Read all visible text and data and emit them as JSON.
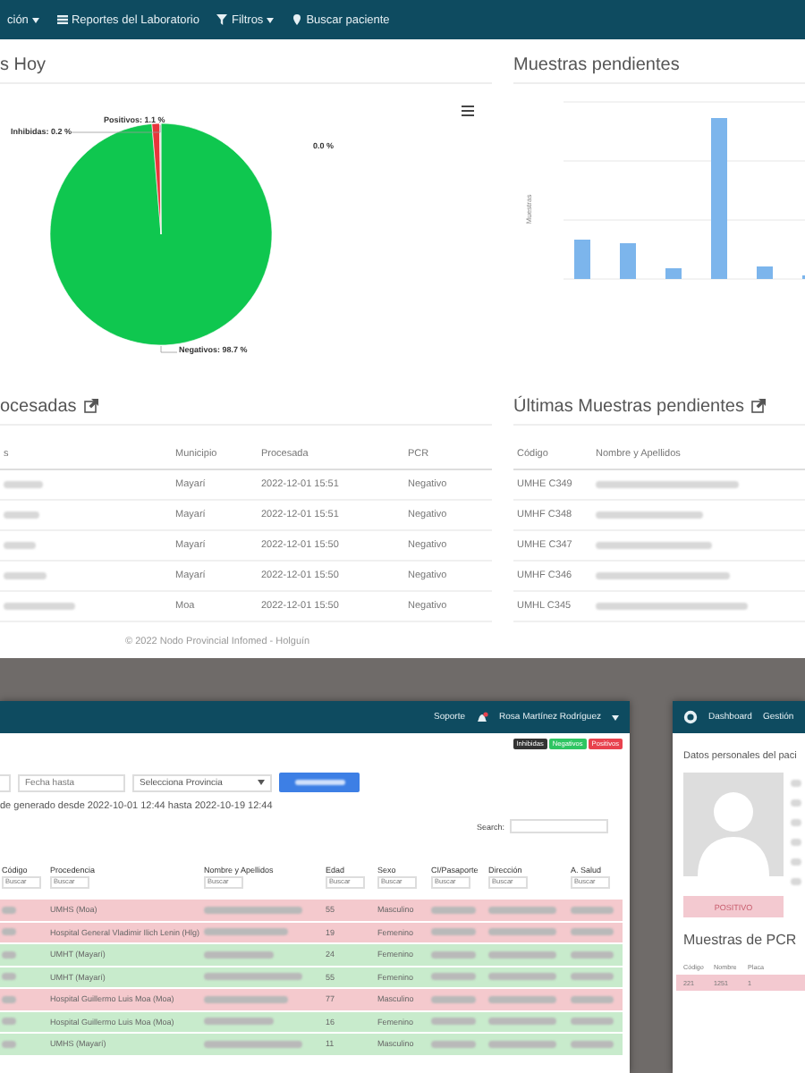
{
  "navbar": {
    "items": [
      {
        "label": "ción",
        "kind": "menu"
      },
      {
        "label": "Reportes del Laboratorio",
        "kind": "link"
      },
      {
        "label": "Filtros",
        "kind": "menu"
      },
      {
        "label": "Buscar paciente",
        "kind": "link"
      }
    ]
  },
  "results_panel": {
    "title": "s Hoy",
    "chart_data": {
      "type": "pie",
      "values": [
        98.7,
        1.1,
        0.2,
        0.0
      ],
      "value_labels": [
        "Negativos: 98.7 %",
        "Positivos: 1.1 %",
        "Inhibidas: 0.2 %",
        "0.0 %"
      ]
    }
  },
  "pending_panel": {
    "title": "Muestras pendientes",
    "ylabel": "Muestras"
  },
  "processed_table": {
    "title": "ocesadas",
    "columns": [
      "s",
      "Municipio",
      "Procesada",
      "PCR"
    ],
    "rows": [
      {
        "municipio": "Mayarí",
        "procesada": "2022-12-01 15:51",
        "pcr": "Negativo"
      },
      {
        "municipio": "Mayarí",
        "procesada": "2022-12-01 15:51",
        "pcr": "Negativo"
      },
      {
        "municipio": "Mayarí",
        "procesada": "2022-12-01 15:50",
        "pcr": "Negativo"
      },
      {
        "municipio": "Mayarí",
        "procesada": "2022-12-01 15:50",
        "pcr": "Negativo"
      },
      {
        "municipio": "Moa",
        "procesada": "2022-12-01 15:50",
        "pcr": "Negativo"
      }
    ]
  },
  "pending_table": {
    "title": "Últimas Muestras pendientes",
    "columns": [
      "Código",
      "Nombre y Apellidos"
    ],
    "rows": [
      {
        "codigo": "UMHE C349"
      },
      {
        "codigo": "UMHF C348"
      },
      {
        "codigo": "UMHE C347"
      },
      {
        "codigo": "UMHF C346"
      },
      {
        "codigo": "UMHL C345"
      }
    ]
  },
  "footer": "© 2022 Nodo Provincial Infomed - Holguín",
  "report_window": {
    "nav": {
      "support": "Soporte",
      "user": "Rosa Martínez Rodríguez"
    },
    "badges": [
      {
        "label": "Inhibidas",
        "kind": "dark"
      },
      {
        "label": "Negativos",
        "kind": "green"
      },
      {
        "label": "Positivos",
        "kind": "red"
      }
    ],
    "date_placeholder": "Fecha hasta",
    "province_select": "Selecciona Provincia",
    "summary": "de generado desde 2022-10-01 12:44 hasta 2022-10-19 12:44",
    "search_label": "Search:",
    "columns": [
      "Código",
      "Procedencia",
      "Nombre y Apellidos",
      "Edad",
      "Sexo",
      "CI/Pasaporte",
      "Dirección",
      "A. Salud"
    ],
    "filter_placeholders": [
      "Buscar",
      "Buscar",
      "Buscar",
      "Buscar",
      "Buscar",
      "Buscar",
      "Buscar",
      "Buscar"
    ],
    "rows": [
      {
        "color": "#f4c9cd",
        "procedencia": "UMHS (Moa)",
        "edad": "55",
        "sexo": "Masculino"
      },
      {
        "color": "#f4c9cd",
        "procedencia": "Hospital General Vladimir Ilich Lenin (Hlg)",
        "edad": "19",
        "sexo": "Femenino"
      },
      {
        "color": "#c8ebcc",
        "procedencia": "UMHT (Mayarí)",
        "edad": "24",
        "sexo": "Femenino"
      },
      {
        "color": "#c8ebcc",
        "procedencia": "UMHT (Mayarí)",
        "edad": "55",
        "sexo": "Femenino"
      },
      {
        "color": "#f4c9cd",
        "procedencia": "Hospital Guillermo Luis Moa (Moa)",
        "edad": "77",
        "sexo": "Masculino"
      },
      {
        "color": "#c8ebcc",
        "procedencia": "Hospital Guillermo Luis Moa (Moa)",
        "edad": "16",
        "sexo": "Femenino"
      },
      {
        "color": "#c8ebcc",
        "procedencia": "UMHS (Mayarí)",
        "edad": "11",
        "sexo": "Masculino"
      }
    ]
  },
  "patient_window": {
    "nav": [
      "Dashboard",
      "Gestión"
    ],
    "title": "Datos personales del paci",
    "status": "POSITIVO",
    "pcr_title": "Muestras de PCR",
    "columns": [
      "Código",
      "Nombre",
      "Placa"
    ],
    "row": [
      "221",
      "1251",
      "1"
    ]
  }
}
